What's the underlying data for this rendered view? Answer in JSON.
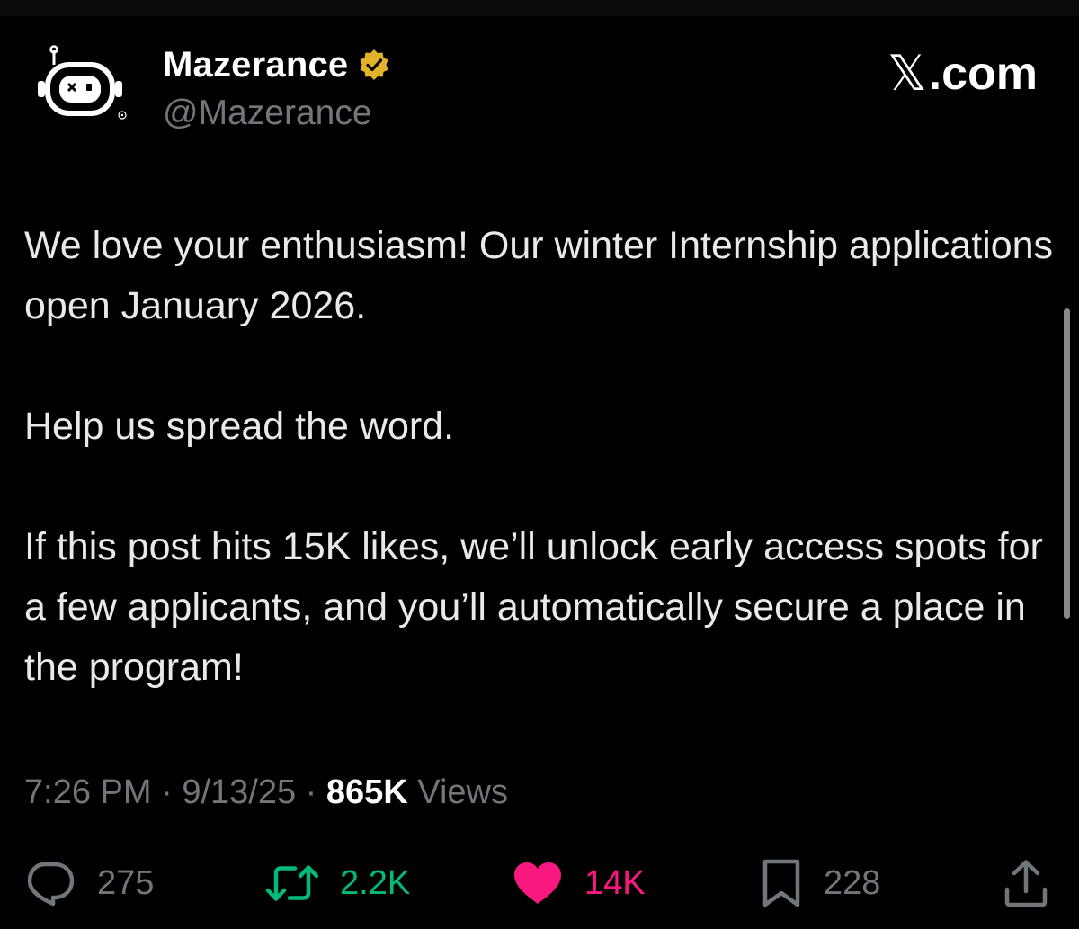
{
  "author": {
    "display_name": "Mazerance",
    "handle": "@Mazerance",
    "verified_icon": "verified-badge-icon",
    "verified_color": "#f4c430"
  },
  "brand": {
    "label": ".com",
    "mark": "𝕏"
  },
  "post": {
    "paragraphs": [
      "We love your enthusiasm! Our winter Internship applications open January 2026.",
      "Help us spread the word.",
      "If this post hits 15K likes, we’ll unlock early access spots for a few applicants, and you’ll automatically secure a place in the program!"
    ]
  },
  "meta": {
    "time": "7:26 PM",
    "date": "9/13/25",
    "views_count": "865K",
    "views_label": "Views",
    "separator": "·"
  },
  "actions": {
    "replies": "275",
    "reposts": "2.2K",
    "likes": "14K",
    "bookmarks": "228"
  },
  "colors": {
    "background": "#000000",
    "text": "#e7e9ea",
    "secondary": "#71767b",
    "repost": "#00ba7c",
    "like": "#f91880"
  }
}
